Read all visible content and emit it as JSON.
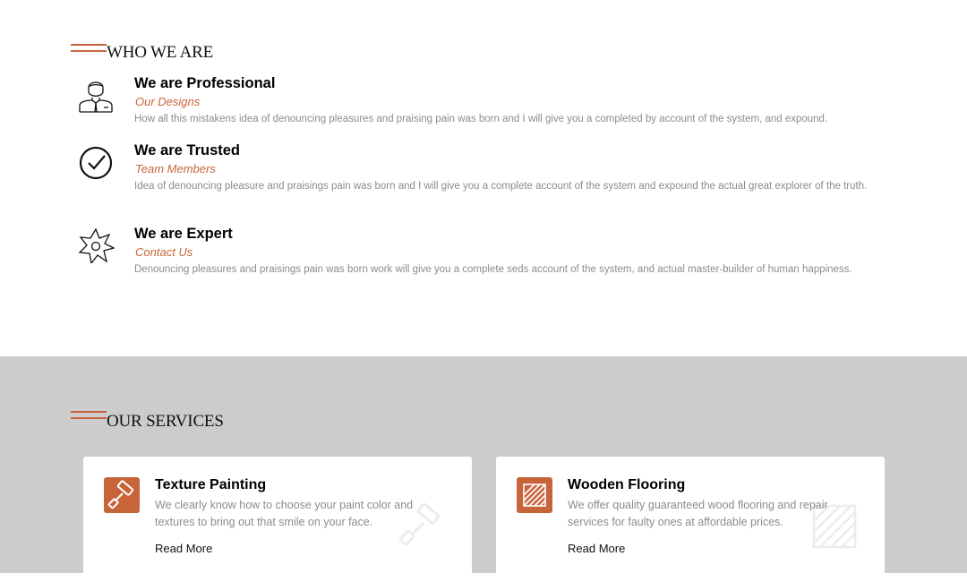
{
  "who_we_are": {
    "heading": "WHO WE ARE",
    "items": [
      {
        "icon": "professional-person-icon",
        "title": "We are Professional",
        "subtitle": "Our Designs",
        "description": "How all this mistakens idea of denouncing pleasures and praising pain was born and I will give you a completed by account of the system, and expound."
      },
      {
        "icon": "checkmark-circle-icon",
        "title": "We are Trusted",
        "subtitle": "Team Members",
        "description": "Idea of denouncing pleasure and praisings pain was born and I will give you a complete account of the system and expound the actual great explorer of the truth."
      },
      {
        "icon": "expert-star-icon",
        "title": "We are Expert",
        "subtitle": "Contact Us",
        "description": "Denouncing pleasures and praisings pain was born work will give you a complete seds account of the system, and actual master-builder of human happiness."
      }
    ]
  },
  "services": {
    "heading": "OUR SERVICES",
    "cards": [
      {
        "icon": "paint-roller-icon",
        "title": "Texture Painting",
        "description": "We clearly know how to choose your paint color and textures to bring out that smile on your face.",
        "link": "Read More"
      },
      {
        "icon": "wood-floor-icon",
        "title": "Wooden Flooring",
        "description": "We offer quality guaranteed wood flooring and repair services for faulty ones at affordable prices.",
        "link": "Read More"
      }
    ]
  },
  "colors": {
    "accent": "#c8643a",
    "services_background": "#cccccc",
    "muted_text": "#8c8c8c"
  }
}
